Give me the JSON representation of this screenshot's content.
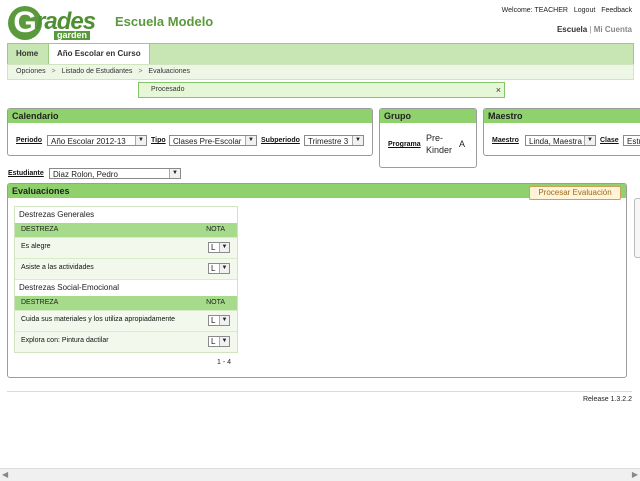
{
  "header": {
    "logo_main": "rades",
    "logo_letter": "G",
    "logo_sub": "garden",
    "school": "Escuela Modelo",
    "welcome": "Welcome: TEACHER",
    "logout": "Logout",
    "feedback": "Feedback",
    "link_school": "Escuela",
    "link_sep": "|",
    "link_account": "Mi Cuenta"
  },
  "nav": {
    "tabs": [
      {
        "label": "Home"
      },
      {
        "label": "Año Escolar en Curso"
      }
    ],
    "breadcrumbs": [
      "Opciones",
      ">",
      "Listado de Estudiantes",
      ">",
      "Evaluaciones"
    ]
  },
  "message": {
    "text": "Procesado",
    "close": "×"
  },
  "calendario": {
    "title": "Calendario",
    "periodo_label": "Periodo",
    "periodo_value": "Año Escolar 2012-13",
    "tipo_label": "Tipo",
    "tipo_value": "Clases Pre-Escolar",
    "subperiodo_label": "Subperiodo",
    "subperiodo_value": "Trimestre 3"
  },
  "grupo": {
    "title": "Grupo",
    "programa_label": "Programa",
    "programa_value_1": "Pre-",
    "programa_value_2": "Kinder",
    "grupo_value": "A"
  },
  "maestro": {
    "title": "Maestro",
    "maestro_label": "Maestro",
    "maestro_value": "Linda, Maestra",
    "clase_label": "Clase",
    "clase_value": "Estu"
  },
  "estudiante": {
    "label": "Estudiante",
    "value": "Diaz Rolon, Pedro"
  },
  "evaluaciones": {
    "title": "Evaluaciones",
    "process_button": "Procesar Evaluación",
    "sections": [
      {
        "name": "Destrezas Generales",
        "col_left": "DESTREZA",
        "col_right": "NOTA",
        "rows": [
          {
            "destreza": "Es alegre",
            "nota": "L"
          },
          {
            "destreza": "Asiste a las actividades",
            "nota": "L"
          }
        ]
      },
      {
        "name": "Destrezas Social-Emocional",
        "col_left": "DESTREZA",
        "col_right": "NOTA",
        "rows": [
          {
            "destreza": "Cuida sus materiales y los utiliza apropiadamente",
            "nota": "L"
          },
          {
            "destreza": "Explora con: Pintura dactilar",
            "nota": "L"
          }
        ]
      }
    ],
    "pager": "1 - 4"
  },
  "footer": {
    "release": "Release 1.3.2.2"
  },
  "icons": {
    "dropdown": "chevron-down-icon",
    "close": "close-icon"
  },
  "colors": {
    "accent": "#5a9a3c",
    "panel_header": "#8fd16d",
    "column_header": "#a5db8a",
    "message_bg": "#e6f7d8"
  }
}
